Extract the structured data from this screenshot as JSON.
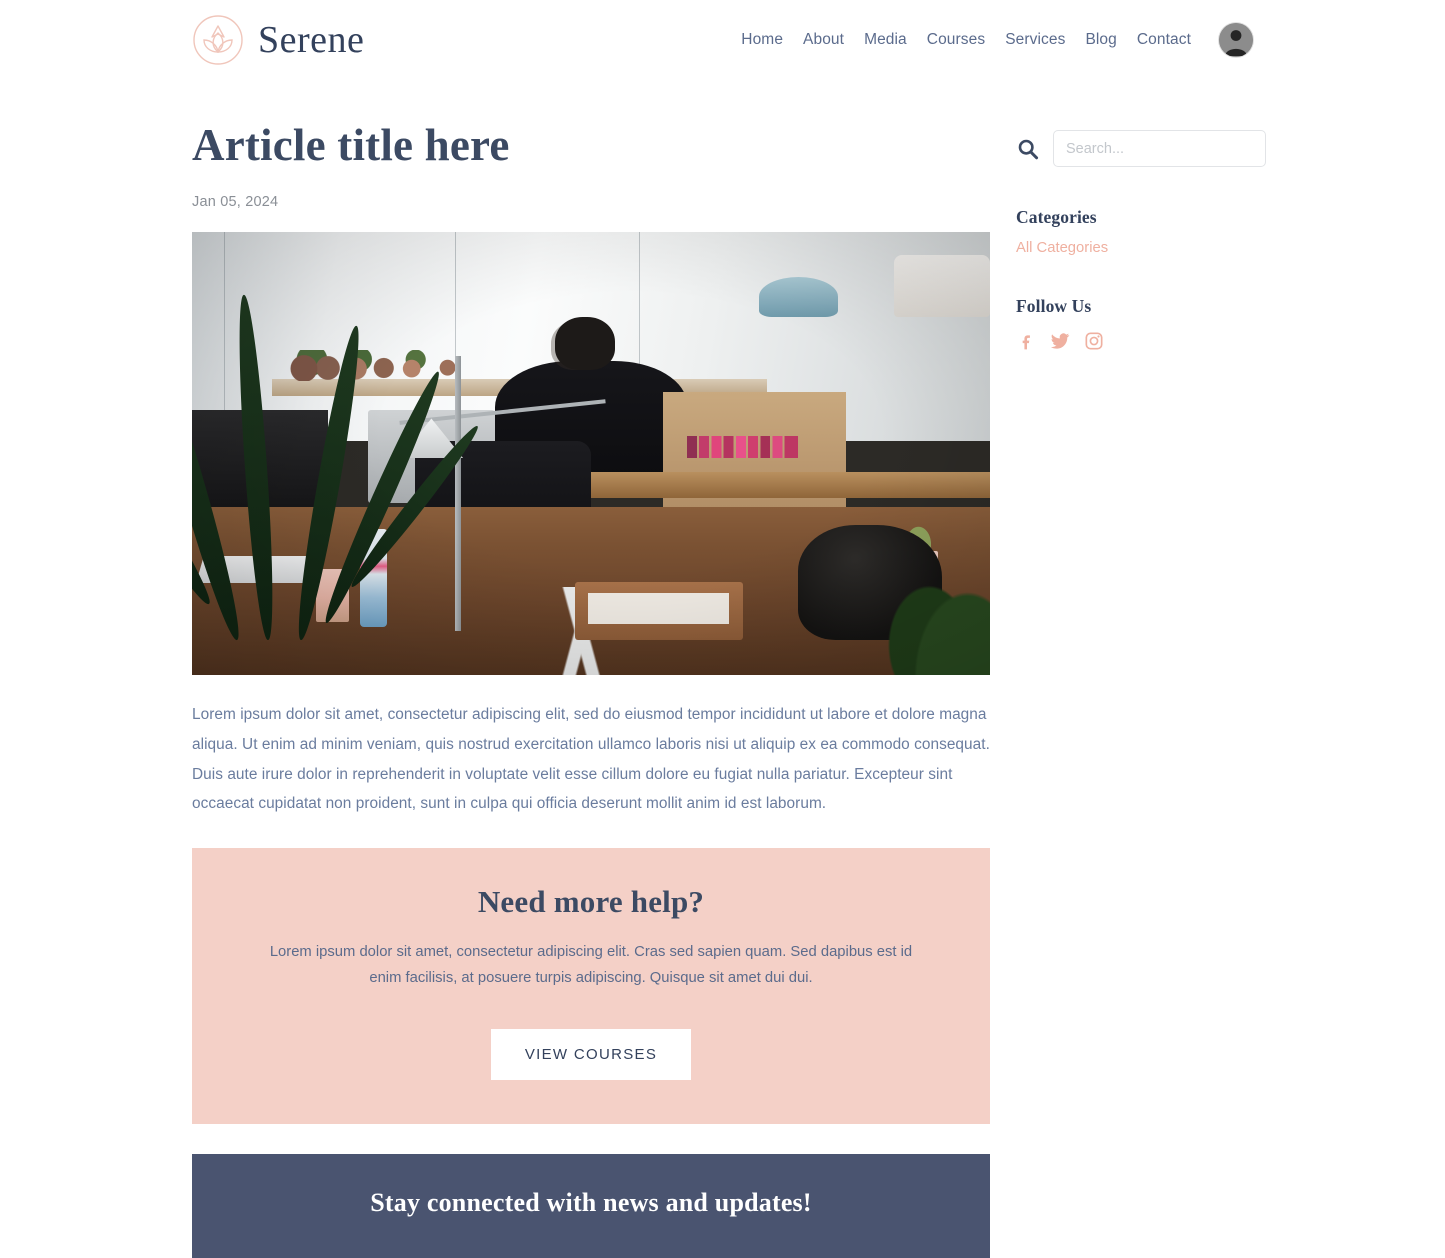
{
  "header": {
    "brand_name": "Serene",
    "logo_icon": "lotus-flower-icon",
    "nav": [
      {
        "label": "Home"
      },
      {
        "label": "About"
      },
      {
        "label": "Media"
      },
      {
        "label": "Courses"
      },
      {
        "label": "Services"
      },
      {
        "label": "Blog"
      },
      {
        "label": "Contact"
      }
    ],
    "avatar_icon": "user-avatar-icon"
  },
  "article": {
    "title": "Article title here",
    "date": "Jan 05, 2024",
    "image_alt": "Open-plan office with desks, computers and a person working",
    "body": "Lorem ipsum dolor sit amet, consectetur adipiscing elit, sed do eiusmod tempor incididunt ut labore et dolore magna aliqua. Ut enim ad minim veniam, quis nostrud exercitation ullamco laboris nisi ut aliquip ex ea commodo consequat. Duis aute irure dolor in reprehenderit in voluptate velit esse cillum dolore eu fugiat nulla pariatur. Excepteur sint occaecat cupidatat non proident, sunt in culpa qui officia deserunt mollit anim id est laborum."
  },
  "cta": {
    "heading": "Need more help?",
    "text": "Lorem ipsum dolor sit amet, consectetur adipiscing elit. Cras sed sapien quam. Sed dapibus est id enim facilisis, at posuere turpis adipiscing. Quisque sit amet dui dui.",
    "button_label": "VIEW COURSES",
    "background_color": "#f4d0c7"
  },
  "newsletter": {
    "heading": "Stay connected with news and updates!",
    "background_color": "#4a5470"
  },
  "sidebar": {
    "search": {
      "icon": "search-icon",
      "placeholder": "Search...",
      "value": ""
    },
    "categories": {
      "heading": "Categories",
      "items": [
        {
          "label": "All Categories"
        }
      ]
    },
    "follow": {
      "heading": "Follow Us",
      "links": [
        {
          "icon": "facebook-icon",
          "label": "Facebook"
        },
        {
          "icon": "twitter-icon",
          "label": "Twitter"
        },
        {
          "icon": "instagram-icon",
          "label": "Instagram"
        }
      ]
    }
  },
  "colors": {
    "accent_pink": "#f4d0c7",
    "pink_link": "#efb0a0",
    "navy": "#3c4a63",
    "band_navy": "#4a5470",
    "body_text": "#6a7c9e"
  }
}
